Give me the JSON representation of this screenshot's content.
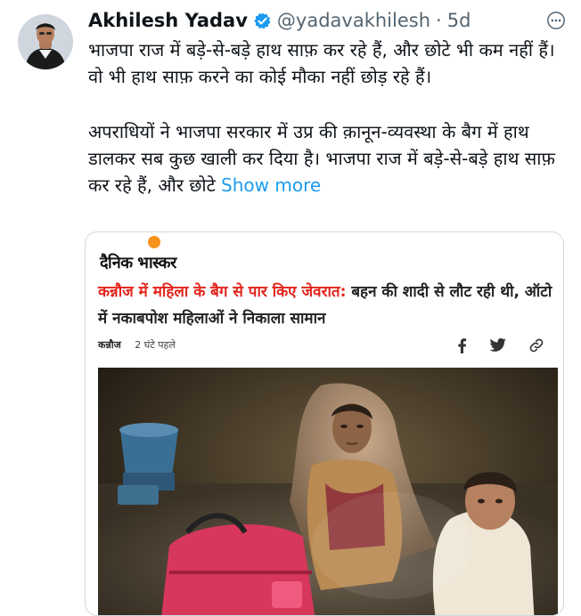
{
  "tweet": {
    "author_name": "Akhilesh Yadav",
    "handle": "@yadavakhilesh",
    "separator": "·",
    "time_ago": "5d",
    "paragraph1": "भाजपा राज में बड़े-से-बड़े हाथ साफ़ कर रहे हैं, और छोटे भी कम नहीं हैं। वो भी हाथ साफ़ करने का कोई मौका नहीं छोड़ रहे हैं।",
    "paragraph2": "अपराधियों ने भाजपा सरकार में उप्र की क़ानून-व्यवस्था के बैग में हाथ डालकर सब कुछ खाली कर दिया है। भाजपा राज में बड़े-से-बड़े हाथ साफ़ कर रहे हैं, और छोटे",
    "show_more": "Show more"
  },
  "card": {
    "brand": "दैनिक भास्कर",
    "headline_highlight": "कन्नौज में महिला के बैग से पार किए जेवरात:",
    "headline_rest": " बहन की शादी से लौट रही थी, ऑटो में नकाबपोश महिलाओं ने निकाला सामान",
    "location": "कन्नौज",
    "time_ago": "2 घंटे पहले"
  },
  "icons": [
    "verified-badge-icon",
    "more-icon",
    "facebook-icon",
    "twitter-icon",
    "link-icon"
  ],
  "colors": {
    "accent": "#1d9bf0",
    "headline_red": "#e2241b",
    "brand_orange": "#f7931d",
    "muted": "#536471"
  }
}
